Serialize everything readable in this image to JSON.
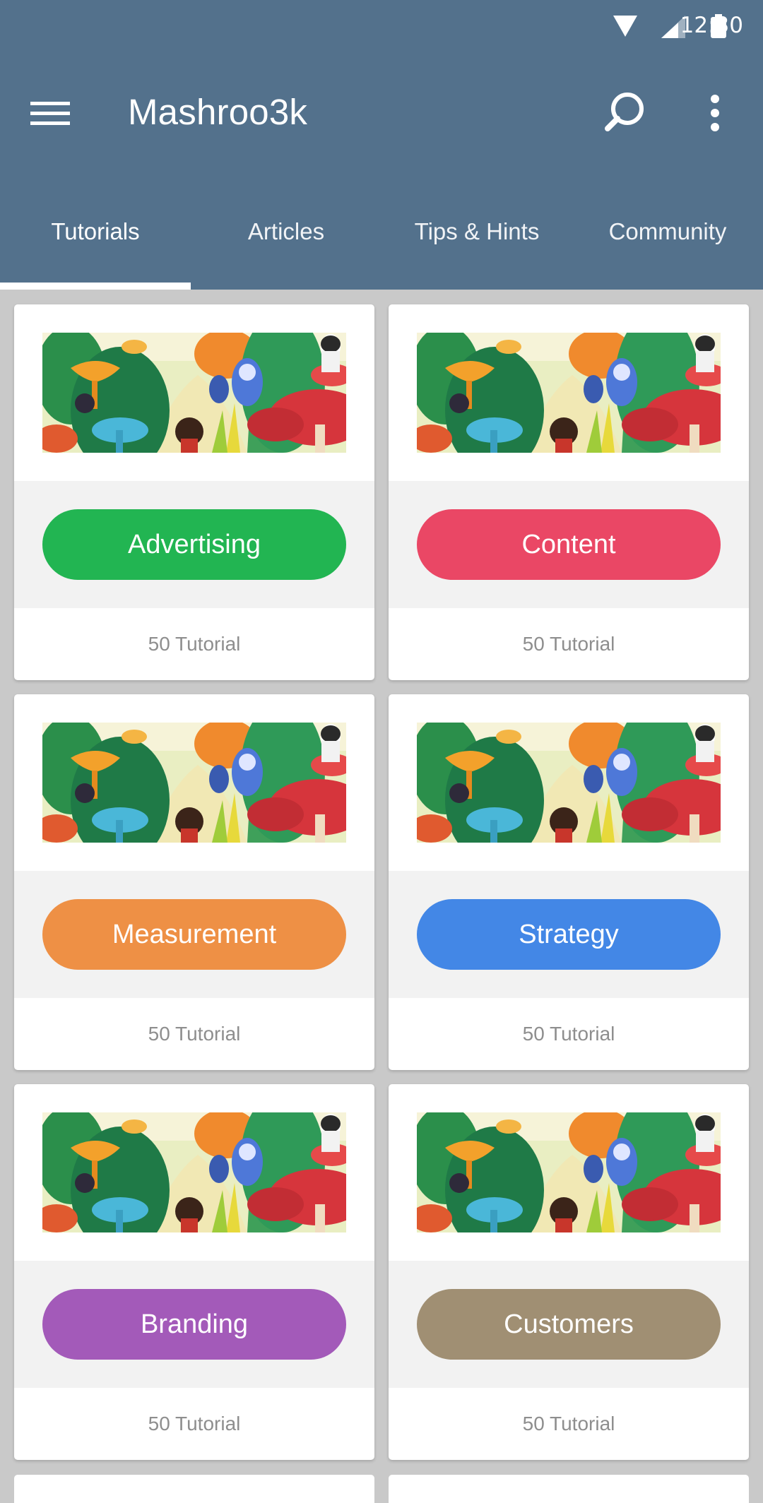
{
  "status_bar": {
    "time": "12:30",
    "icons": [
      "wifi-icon",
      "signal-icon",
      "battery-icon"
    ]
  },
  "toolbar": {
    "title": "Mashroo3k",
    "icons": [
      "menu-icon",
      "search-icon",
      "more-vert-icon"
    ]
  },
  "tabs": [
    {
      "label": "Tutorials",
      "selected": true
    },
    {
      "label": "Articles",
      "selected": false
    },
    {
      "label": "Tips & Hints",
      "selected": false
    },
    {
      "label": "Community",
      "selected": false
    }
  ],
  "colors": {
    "appbar": "#53718c",
    "advertising": "#22b552",
    "content": "#ea4765",
    "measurement": "#ee9045",
    "strategy": "#4387e6",
    "branding": "#a35ab9",
    "customers": "#a08f73"
  },
  "cards": [
    {
      "category": "Advertising",
      "count": "50 Tutorial",
      "color": "#22b552"
    },
    {
      "category": "Content",
      "count": "50 Tutorial",
      "color": "#ea4765"
    },
    {
      "category": "Measurement",
      "count": "50 Tutorial",
      "color": "#ee9045"
    },
    {
      "category": "Strategy",
      "count": "50 Tutorial",
      "color": "#4387e6"
    },
    {
      "category": "Branding",
      "count": "50 Tutorial",
      "color": "#a35ab9"
    },
    {
      "category": "Customers",
      "count": "50 Tutorial",
      "color": "#a08f73"
    }
  ]
}
